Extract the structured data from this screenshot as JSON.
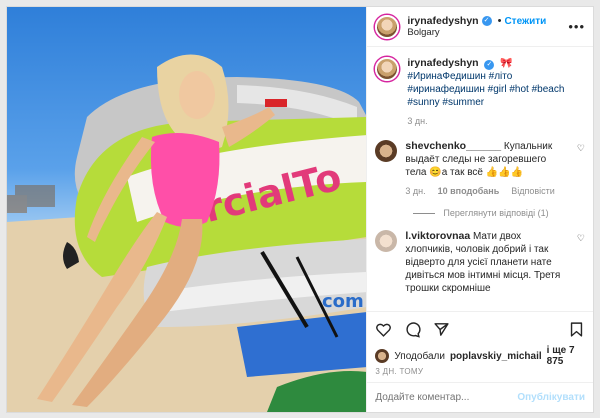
{
  "post": {
    "author": "irynafedyshyn",
    "follow_label": "Стежити",
    "location": "Bolgary",
    "caption": {
      "emoji": "🎀",
      "hashtags_line1": "#ИринаФедишин #літо",
      "hashtags_line2": "#иринафедишин #girl #hot #beach",
      "hashtags_line3": "#sunny #summer",
      "age": "3 дн."
    },
    "comments": [
      {
        "user": "shevchenko______",
        "text": "Купальник выдаёт следы не загоревшего тела 😊а так всё 👍👍👍",
        "age": "3 дн.",
        "likes": "10 вподобань",
        "reply": "Відповісти"
      },
      {
        "user": "l.viktorovnaa",
        "text": "Мати двох хлопчиків, чоловік добрий і так відверто для усієї планети нате дивіться мов інтимні місця. Третя трошки скромніше"
      }
    ],
    "view_replies": "Переглянути відповіді (1)",
    "liked_by": {
      "prefix": "Уподобали",
      "user": "poplavskiy_michail",
      "suffix": "і ще 7 875"
    },
    "time_ago": "3 ДН. ТОМУ",
    "comment_input_placeholder": "Додайте коментар...",
    "publish_label": "Опублікувати"
  },
  "photo": {
    "float_text": "ercialTo",
    "float_text_2": "com"
  },
  "colors": {
    "link_blue": "#0095f6",
    "swimsuit_pink": "#ff4fa8",
    "float_green": "#b6dc3a"
  }
}
